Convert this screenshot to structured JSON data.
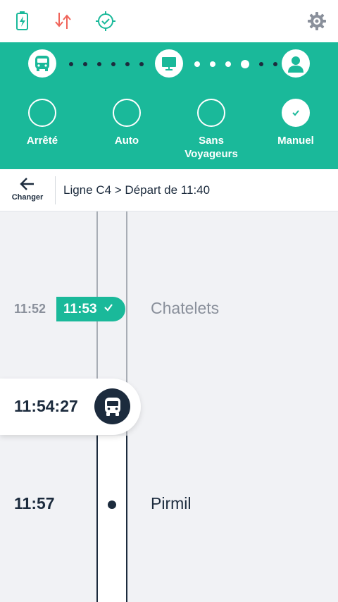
{
  "statusbar": {
    "icons": [
      "battery-charging-icon",
      "data-transfer-icon",
      "gps-target-icon",
      "settings-gear-icon"
    ],
    "colors": {
      "battery": "#1ab99a",
      "transfer": "#f0645a",
      "gps": "#1ab99a",
      "settings": "#8a909b"
    }
  },
  "progress": {
    "icons": [
      "bus-icon",
      "screen-icon",
      "driver-icon"
    ]
  },
  "modes": [
    {
      "label": "Arrêté",
      "checked": false
    },
    {
      "label": "Auto",
      "checked": false
    },
    {
      "label": "Sans Voyageurs",
      "checked": false
    },
    {
      "label": "Manuel",
      "checked": true
    }
  ],
  "nav": {
    "back_label": "Changer",
    "breadcrumb": "Ligne C4 > Départ de 11:40"
  },
  "timeline": {
    "stops": [
      {
        "theoretical": "11:52",
        "actual": "11:53",
        "name": "Chatelets",
        "passed": true
      },
      {
        "time": "11:57",
        "name": "Pirmil",
        "passed": false
      }
    ],
    "current_time": "11:54:27"
  },
  "colors": {
    "accent": "#1ab99a",
    "dark": "#1c2b3d",
    "muted": "#8a909b",
    "alert": "#f0645a"
  }
}
